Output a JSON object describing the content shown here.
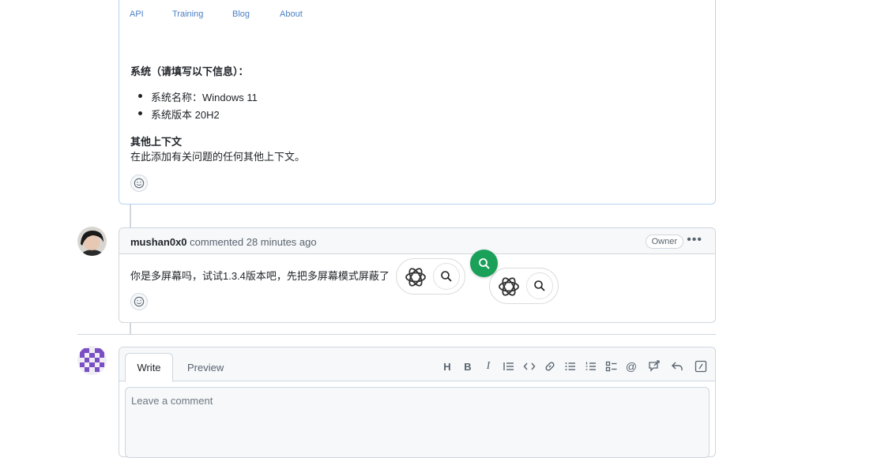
{
  "footer_links": [
    "API",
    "Training",
    "Blog",
    "About"
  ],
  "issue_body": {
    "system_heading": "系统（请填写以下信息）：",
    "system_items": [
      "系统名称：Windows 11",
      "系统版本 20H2"
    ],
    "context_heading": "其他上下文",
    "context_text": "在此添加有关问题的任何其他上下文。"
  },
  "comment": {
    "author": "mushan0x0",
    "action": "commented",
    "time": "28 minutes ago",
    "badge": "Owner",
    "body": "你是多屏幕吗，试试1.3.4版本吧，先把多屏幕模式屏蔽了"
  },
  "editor": {
    "tab_write": "Write",
    "tab_preview": "Preview",
    "placeholder": "Leave a comment",
    "toolbar_icons": [
      "heading-icon",
      "bold-icon",
      "italic-icon",
      "quote-icon",
      "code-icon",
      "link-icon",
      "unordered-list-icon",
      "ordered-list-icon",
      "task-list-icon",
      "mention-icon",
      "reference-icon",
      "reply-icon",
      "slash-commands-icon"
    ]
  },
  "colors": {
    "accent_link": "#4b7fc4",
    "overlay_green": "#1aa059"
  }
}
